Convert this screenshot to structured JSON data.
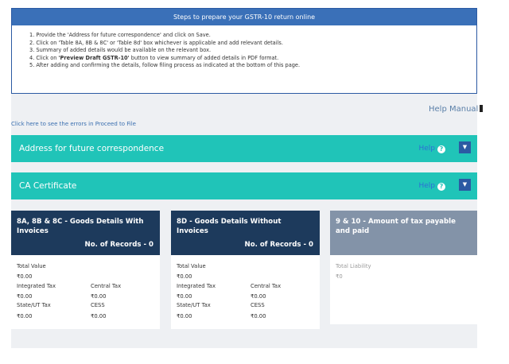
{
  "steps": {
    "title": "Steps to prepare your GSTR-10 return online",
    "items": [
      "1. Provide the 'Address for future correspondence' and click on Save.",
      "2. Click on 'Table 8A, 8B & 8C' or 'Table 8d' box whichever is applicable and add relevant details.",
      "3. Summary of added details would be available on the relevant box.",
      "4. Click on ",
      "5. After adding and confirming the details, follow filing process as indicated at the bottom of this page."
    ],
    "step4_bold": "'Preview Draft GSTR-10'",
    "step4_rest": " button to view summary of added details in PDF format."
  },
  "help_manual": "Help Manual",
  "errors_link": "Click here to see the errors in Proceed to File",
  "sections": [
    {
      "title": "Address for future correspondence",
      "help": "Help"
    },
    {
      "title": "CA Certificate",
      "help": "Help"
    }
  ],
  "cards": [
    {
      "title": "8A, 8B & 8C - Goods Details With Invoices",
      "count": "No. of Records - 0",
      "total_value_label": "Total Value",
      "total_value": "₹0.00",
      "integrated_label": "Integrated Tax",
      "central_label": "Central Tax",
      "integrated": "₹0.00",
      "central": "₹0.00",
      "state_label": "State/UT Tax",
      "cess_label": "CESS",
      "state": "₹0.00",
      "cess": "₹0.00"
    },
    {
      "title": "8D - Goods Details Without Invoices",
      "count": "No. of Records - 0",
      "total_value_label": "Total Value",
      "total_value": "₹0.00",
      "integrated_label": "Integrated Tax",
      "central_label": "Central Tax",
      "integrated": "₹0.00",
      "central": "₹0.00",
      "state_label": "State/UT Tax",
      "cess_label": "CESS",
      "state": "₹0.00",
      "cess": "₹0.00"
    },
    {
      "title": "9 & 10 - Amount of tax payable and paid",
      "liability_label": "Total Liability",
      "liability": "₹0"
    }
  ],
  "icons": {
    "help": "question-circle-icon",
    "expand": "chevron-down-icon"
  },
  "colors": {
    "header_blue": "#3a70b8",
    "teal": "#20c4b8",
    "card_navy": "#1d3a5c",
    "card_gray": "#8393a8"
  }
}
